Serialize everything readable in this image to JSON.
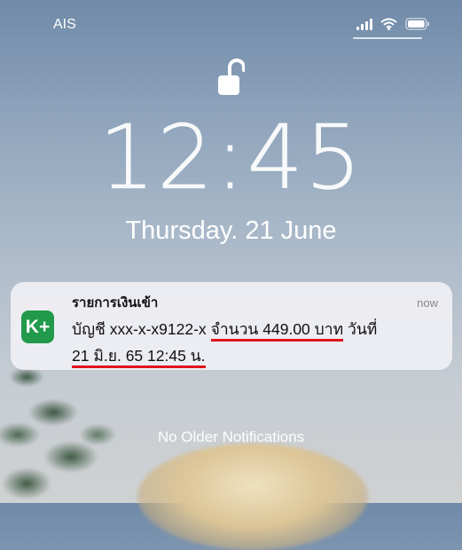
{
  "status_bar": {
    "carrier": "AIS"
  },
  "lock_screen": {
    "time": "12:45",
    "date": "Thursday. 21 June"
  },
  "notification": {
    "app_icon_text": "K+",
    "title": "รายการเงินเข้า",
    "time": "now",
    "account_text": "บัญชี xxx-x-x9122-x",
    "amount_text": "จำนวน 449.00 บาท",
    "date_label": "วันที่",
    "date_text": "21 มิ.ย. 65 12:45 น.",
    "icon_color": "#229a4c",
    "highlight_color": "#e0141c"
  },
  "footer": {
    "no_older": "No Older Notifications"
  }
}
